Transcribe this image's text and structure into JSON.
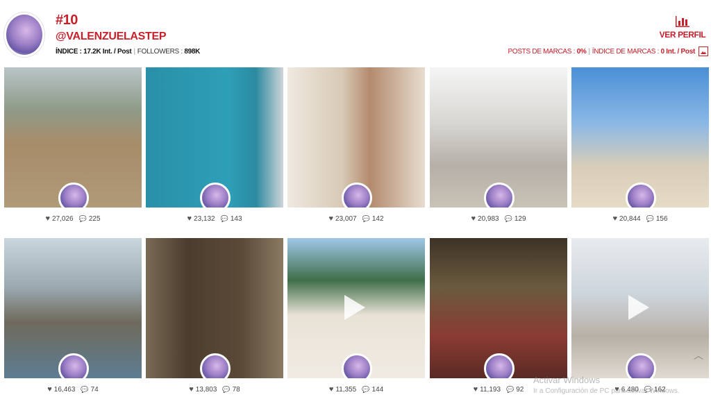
{
  "profile": {
    "rank": "#10",
    "username": "@VALENZUELASTEP",
    "index_label": "ÍNDICE :",
    "index_value": "17.2K Int. / Post",
    "followers_label": "FOLLOWERS :",
    "followers_value": "898K",
    "separator": "|"
  },
  "actions": {
    "ver_perfil_label": "VER PERFIL",
    "brand_posts_label": "POSTS DE MARCAS :",
    "brand_posts_value": "0%",
    "brand_index_label": "ÍNDICE DE MARCAS :",
    "brand_index_value": "0 Int. / Post"
  },
  "posts": [
    {
      "likes": "27,026",
      "comments": "225",
      "video": false,
      "bg": "linear-gradient(180deg,#b9c5c7 0%,#8f9b88 30%,#a88c6a 55%,#b09a78 100%)"
    },
    {
      "likes": "23,132",
      "comments": "143",
      "video": false,
      "bg": "linear-gradient(90deg,#2a8fa8 0%,#2e9fb8 60%,#2b8aa0 80%,#cfd5d8 100%)"
    },
    {
      "likes": "23,007",
      "comments": "142",
      "video": false,
      "bg": "linear-gradient(90deg,#efe9e0 0%,#d7c9b5 40%,#b48a6e 60%,#e7ddd0 100%)"
    },
    {
      "likes": "20,983",
      "comments": "129",
      "video": false,
      "bg": "linear-gradient(180deg,#f5f5f5 0%,#d8d6d2 40%,#b5b0a8 70%,#c9c2b6 100%)"
    },
    {
      "likes": "20,844",
      "comments": "156",
      "video": false,
      "bg": "linear-gradient(180deg,#4a8fd6 0%,#8bb8e6 40%,#d7cdb8 70%,#e6dcc6 100%)"
    },
    {
      "likes": "16,463",
      "comments": "74",
      "video": false,
      "bg": "linear-gradient(180deg,#c9d6de 0%,#9aa9b0 35%,#6f6a5c 60%,#5d7d92 100%)"
    },
    {
      "likes": "13,803",
      "comments": "78",
      "video": false,
      "bg": "linear-gradient(90deg,#7a6a55 0%,#4b3d2e 30%,#5c4a38 70%,#8a7a63 100%)"
    },
    {
      "likes": "11,355",
      "comments": "144",
      "video": true,
      "bg": "linear-gradient(180deg,#9fc7e8 0%,#3f6f4a 30%,#e9e2d6 55%,#f0ebe3 100%)"
    },
    {
      "likes": "11,193",
      "comments": "92",
      "video": false,
      "bg": "linear-gradient(180deg,#3d3326 0%,#6a5a3e 35%,#8a3b33 70%,#5a2a24 100%)"
    },
    {
      "likes": "6,480",
      "comments": "162",
      "video": true,
      "bg": "linear-gradient(180deg,#e8ebee 0%,#cdd5dc 40%,#b7b0a6 70%,#e1dad2 100%)"
    }
  ],
  "icons": {
    "heart": "♥",
    "comment": "💬",
    "scroll_up": "︿"
  },
  "watermark": {
    "title": "Activar Windows",
    "subtitle": "Ir a Configuración de PC para activar Windows."
  },
  "colors": {
    "accent": "#c8202a"
  }
}
